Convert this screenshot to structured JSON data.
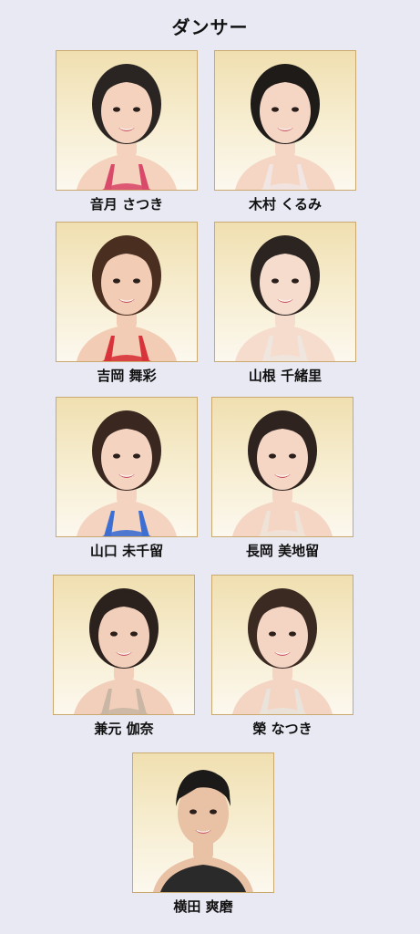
{
  "title": "ダンサー",
  "dancers": [
    {
      "name": "音月 さつき",
      "hair": "#2a2522",
      "top": "#d94a6a",
      "skin": "#f4d2bd"
    },
    {
      "name": "木村 くるみ",
      "hair": "#1f1b19",
      "top": "#f1e6e3",
      "skin": "#f5d6c4"
    },
    {
      "name": "吉岡 舞彩",
      "hair": "#4a2e20",
      "top": "#d8333a",
      "skin": "#f2ccb4"
    },
    {
      "name": "山根 千緒里",
      "hair": "#2b2421",
      "top": "#efe6df",
      "skin": "#f6dccd"
    },
    {
      "name": "山口 未千留",
      "hair": "#3a2820",
      "top": "#3d6fd3",
      "skin": "#f4d3c1"
    },
    {
      "name": "長岡 美地留",
      "hair": "#2e231f",
      "top": "#efe3d8",
      "skin": "#f5d6c5"
    },
    {
      "name": "兼元 伽奈",
      "hair": "#2b211d",
      "top": "#c9b6a4",
      "skin": "#f2cfba"
    },
    {
      "name": "榮 なつき",
      "hair": "#3a2a22",
      "top": "#e9e3dc",
      "skin": "#f4d4c2"
    },
    {
      "name": "横田 爽磨",
      "hair": "#1c1a19",
      "top": "#2a2a2a",
      "skin": "#e9c1a5"
    }
  ]
}
